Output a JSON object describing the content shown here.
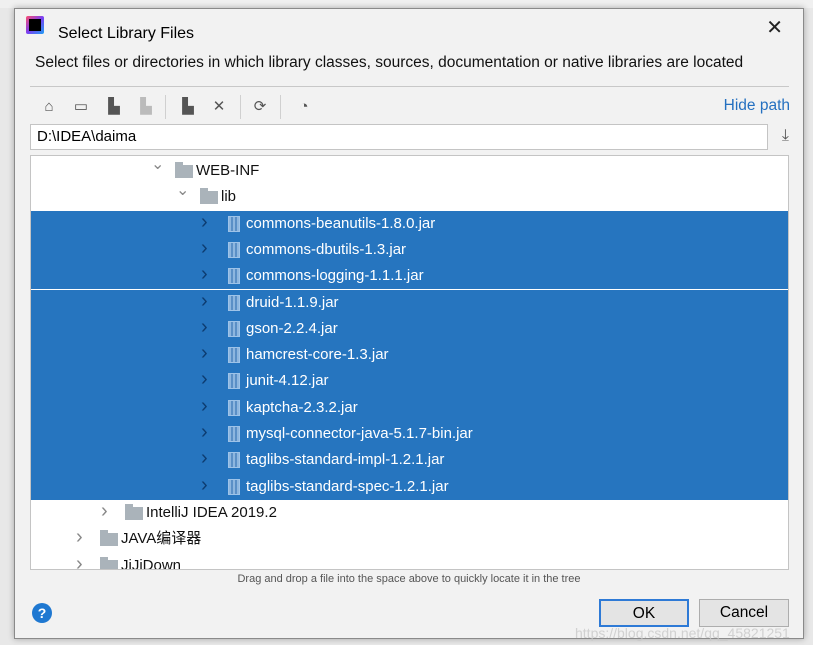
{
  "dialog": {
    "title": "Select Library Files",
    "description": "Select files or directories in which library classes, sources, documentation or native libraries are located"
  },
  "toolbar": {
    "icons": [
      "home-icon",
      "desktop-icon",
      "project-icon",
      "module-icon",
      "new-folder-icon",
      "delete-icon",
      "refresh-icon",
      "show-hidden-icon"
    ],
    "hide_path": "Hide path"
  },
  "path": {
    "value": "D:\\IDEA\\daima"
  },
  "tree": {
    "rows": [
      {
        "label": "WEB-INF",
        "type": "folder",
        "level": 5,
        "expanded": true,
        "selected": false
      },
      {
        "label": "lib",
        "type": "folder",
        "level": 6,
        "expanded": true,
        "selected": false
      },
      {
        "label": "commons-beanutils-1.8.0.jar",
        "type": "jar",
        "level": 7,
        "selected": true
      },
      {
        "label": "commons-dbutils-1.3.jar",
        "type": "jar",
        "level": 7,
        "selected": true
      },
      {
        "label": "commons-logging-1.1.1.jar",
        "type": "jar",
        "level": 7,
        "selected": true
      },
      {
        "label": "druid-1.1.9.jar",
        "type": "jar",
        "level": 7,
        "selected": true
      },
      {
        "label": "gson-2.2.4.jar",
        "type": "jar",
        "level": 7,
        "selected": true
      },
      {
        "label": "hamcrest-core-1.3.jar",
        "type": "jar",
        "level": 7,
        "selected": true
      },
      {
        "label": "junit-4.12.jar",
        "type": "jar",
        "level": 7,
        "selected": true
      },
      {
        "label": "kaptcha-2.3.2.jar",
        "type": "jar",
        "level": 7,
        "selected": true
      },
      {
        "label": "mysql-connector-java-5.1.7-bin.jar",
        "type": "jar",
        "level": 7,
        "selected": true
      },
      {
        "label": "taglibs-standard-impl-1.2.1.jar",
        "type": "jar",
        "level": 7,
        "selected": true
      },
      {
        "label": "taglibs-standard-spec-1.2.1.jar",
        "type": "jar",
        "level": 7,
        "selected": true
      },
      {
        "label": "IntelliJ IDEA 2019.2",
        "type": "folder",
        "level": 3,
        "expanded": false,
        "selected": false
      },
      {
        "label": "JAVA编译器",
        "type": "folder",
        "level": 2,
        "expanded": false,
        "selected": false
      },
      {
        "label": "JiJiDown",
        "type": "folder",
        "level": 2,
        "expanded": false,
        "selected": false
      }
    ]
  },
  "hint": "Drag and drop a file into the space above to quickly locate it in the tree",
  "buttons": {
    "ok": "OK",
    "cancel": "Cancel"
  },
  "watermark": "https://blog.csdn.net/qq_45821251",
  "colors": {
    "selection": "#2675bf",
    "link": "#2470c0",
    "help": "#1f78d1"
  }
}
